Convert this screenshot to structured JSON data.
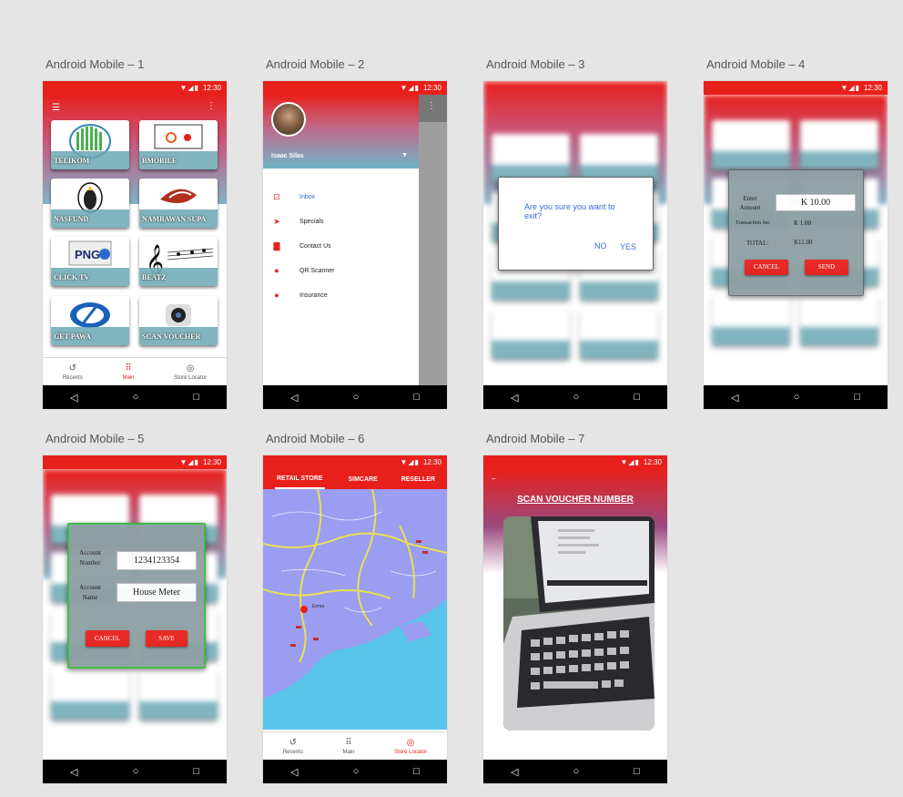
{
  "labels": [
    "Android Mobile – 1",
    "Android Mobile – 2",
    "Android Mobile – 3",
    "Android Mobile – 4",
    "Android Mobile – 5",
    "Android Mobile – 6",
    "Android Mobile – 7"
  ],
  "status": {
    "time": "12:30"
  },
  "tiles": [
    "TELIKOM",
    "BMOBILE",
    "NASFUND",
    "NAMBAWAN SUPA",
    "CLICK TV",
    "BEATZ",
    "GET PAWA",
    "SCAN VOUCHER"
  ],
  "bottom_nav": {
    "recents": "Recents",
    "main": "Main",
    "store_locator": "Store Locator"
  },
  "drawer": {
    "user_name": "Isaac Silas",
    "items": [
      "Inbox",
      "Specials",
      "Contact Us",
      "QR Scanner",
      "Insurance"
    ]
  },
  "exit_dialog": {
    "message": "Are you sure you want to exit?",
    "no": "NO",
    "yes": "YES"
  },
  "payment_dialog": {
    "enter_amount_label": "Enter Amount",
    "amount_value": "K 10.00",
    "fee_label": "Transaction fee:",
    "fee_value": "K 1.00",
    "total_label": "TOTAL:",
    "total_value": "K11.00",
    "cancel": "CANCEL",
    "send": "SEND"
  },
  "account_dialog": {
    "account_number_label": "Account Number",
    "account_number_value": "1234123354",
    "account_name_label": "Account Name",
    "account_name_value": "House Meter",
    "cancel": "CANCEL",
    "save": "SAVE"
  },
  "map_tabs": [
    "RETAIL STORE",
    "SIMCARE",
    "RESELLER"
  ],
  "map_labels": {
    "place": "Erima"
  },
  "scan_title": "SCAN VOUCHER NUMBER",
  "colors": {
    "brand_red": "#e8201c",
    "teal": "#6aa7b3",
    "map_water": "#58c6ea",
    "map_land": "#9a9df0"
  }
}
